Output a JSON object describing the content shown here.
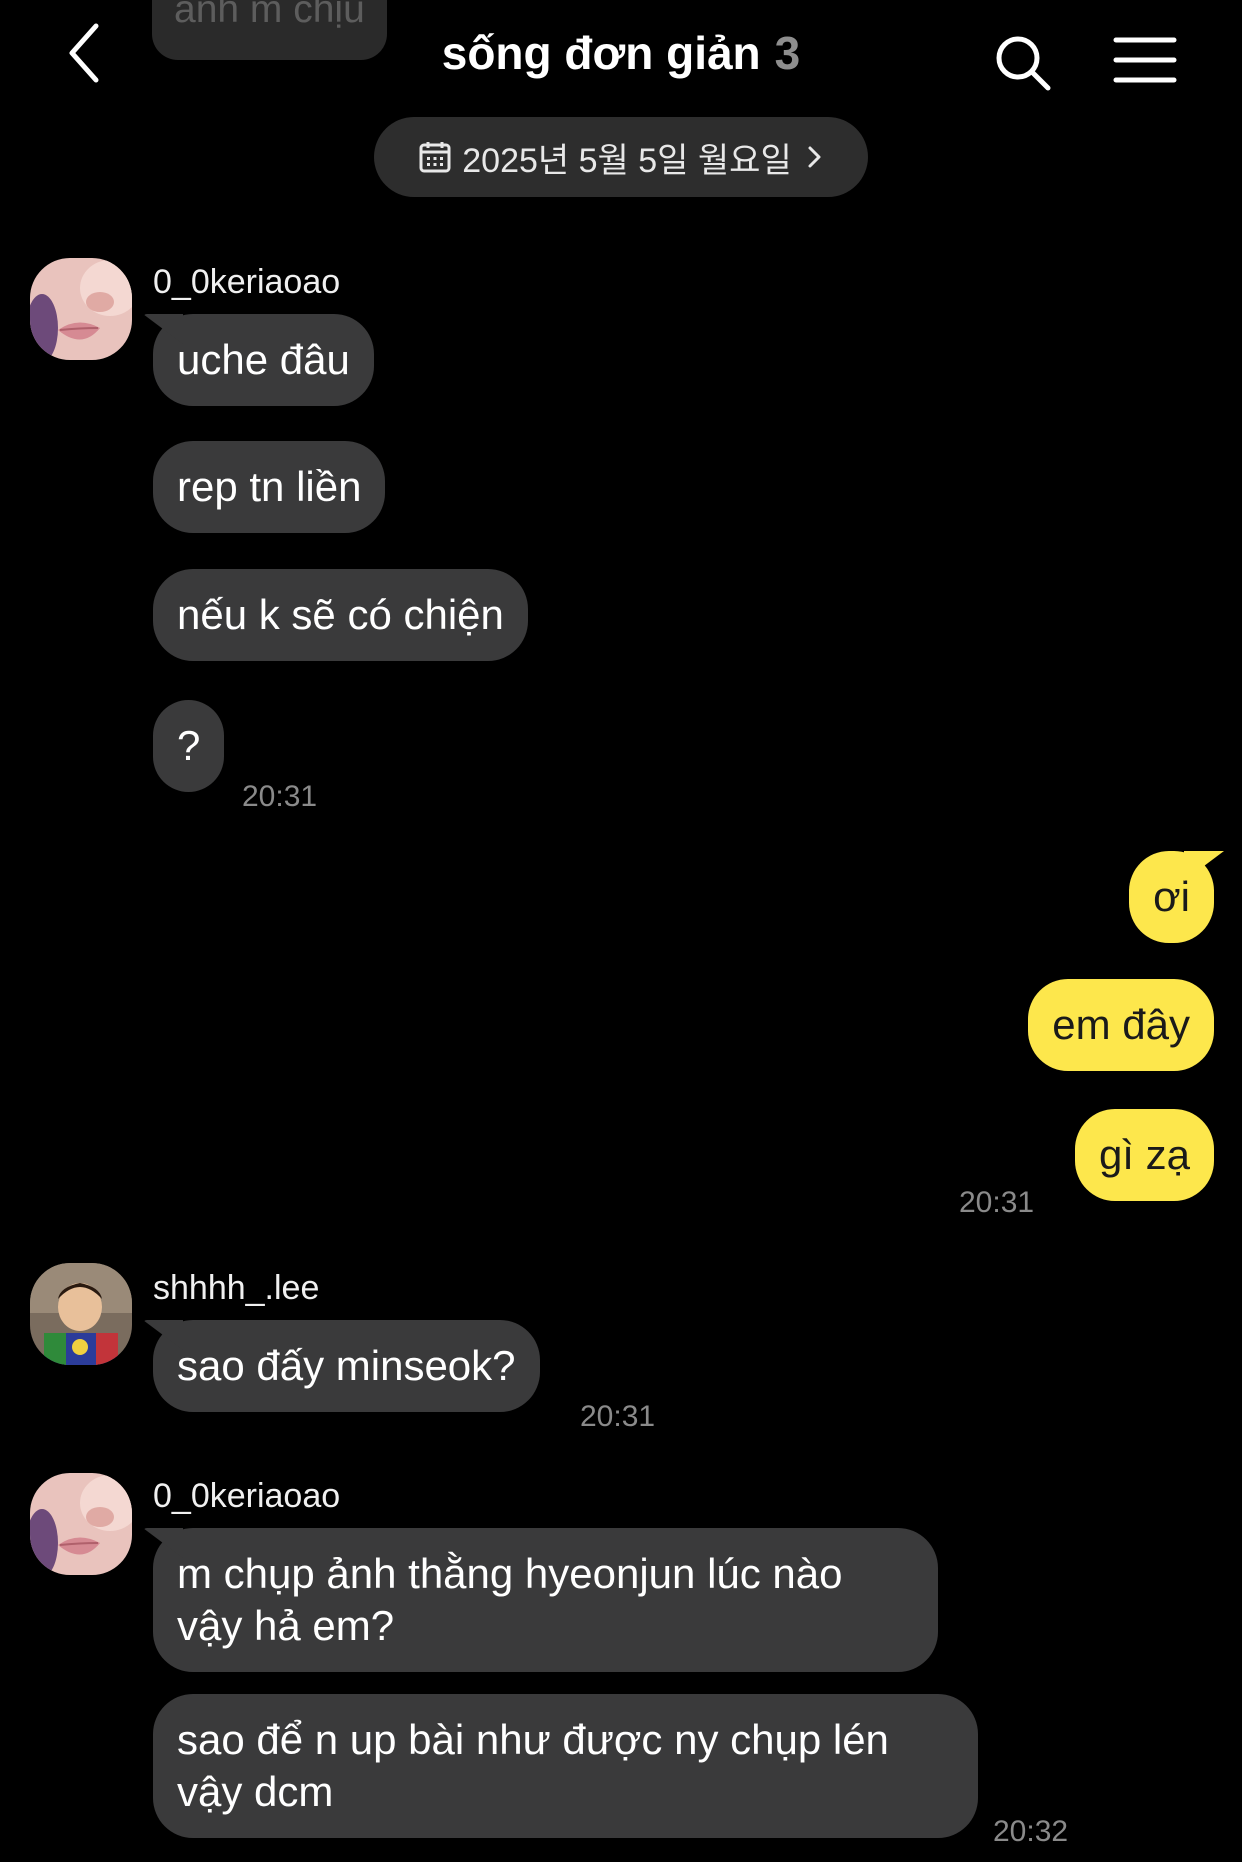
{
  "header": {
    "ghost_text": "anh m chịu",
    "title": "sống đơn giản",
    "member_count": "3"
  },
  "date_pill": {
    "label": "2025년 5월 5일 월요일"
  },
  "messages": {
    "g1": {
      "sender": "0_0keriaoao",
      "m1": "uche đâu",
      "m2": "rep tn liền",
      "m3": "nếu k sẽ có chiện",
      "m4": "?",
      "time": "20:31"
    },
    "me": {
      "m1": "ơi",
      "m2": "em đây",
      "m3": "gì zạ",
      "time": "20:31"
    },
    "g2": {
      "sender": "shhhh_.lee",
      "m1": "sao đấy minseok?",
      "time": "20:31"
    },
    "g3": {
      "sender": "0_0keriaoao",
      "m1": "m chụp ảnh thằng hyeonjun lúc nào vậy hả em?",
      "m2": "sao để n up bài như được ny chụp lén vậy dcm",
      "time": "20:32"
    }
  },
  "colors": {
    "background": "#000000",
    "bubble_other": "#3a3a3b",
    "bubble_me": "#fde74c",
    "timestamp": "#8a8a8a"
  },
  "icons": [
    "back-icon",
    "search-icon",
    "menu-icon",
    "calendar-icon",
    "chevron-right-icon"
  ]
}
